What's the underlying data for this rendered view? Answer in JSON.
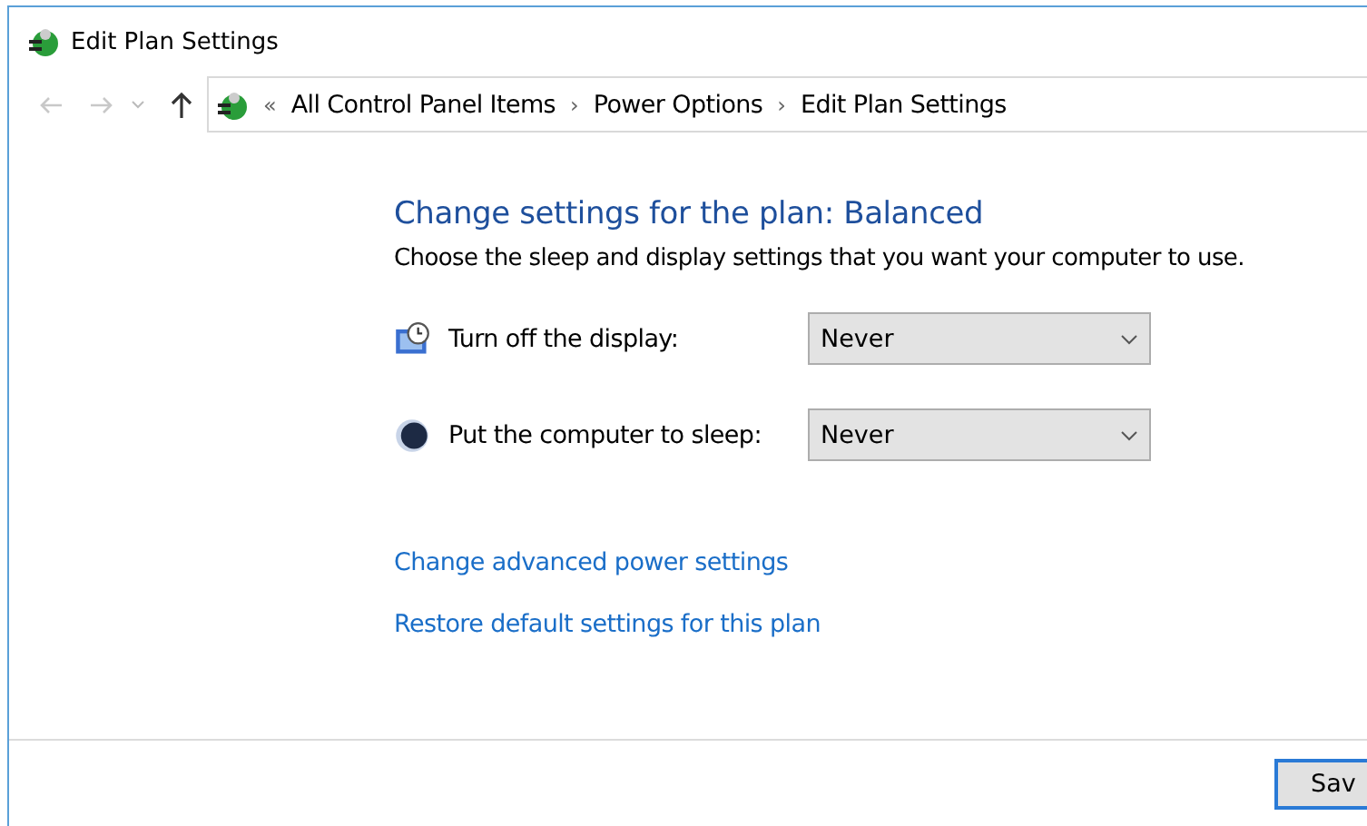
{
  "window": {
    "title": "Edit Plan Settings"
  },
  "nav": {
    "back_disabled": true,
    "forward_disabled": true,
    "up_disabled": false
  },
  "address": {
    "overflow": "«",
    "separator": "›",
    "crumbs": [
      "All Control Panel Items",
      "Power Options",
      "Edit Plan Settings"
    ]
  },
  "heading": "Change settings for the plan: Balanced",
  "subheading": "Choose the sleep and display settings that you want your computer to use.",
  "settings": [
    {
      "kind": "display",
      "label": "Turn off the display:",
      "value": "Never"
    },
    {
      "kind": "sleep",
      "label": "Put the computer to sleep:",
      "value": "Never"
    }
  ],
  "links": [
    "Change advanced power settings",
    "Restore default settings for this plan"
  ],
  "buttons": [
    "Sav"
  ]
}
